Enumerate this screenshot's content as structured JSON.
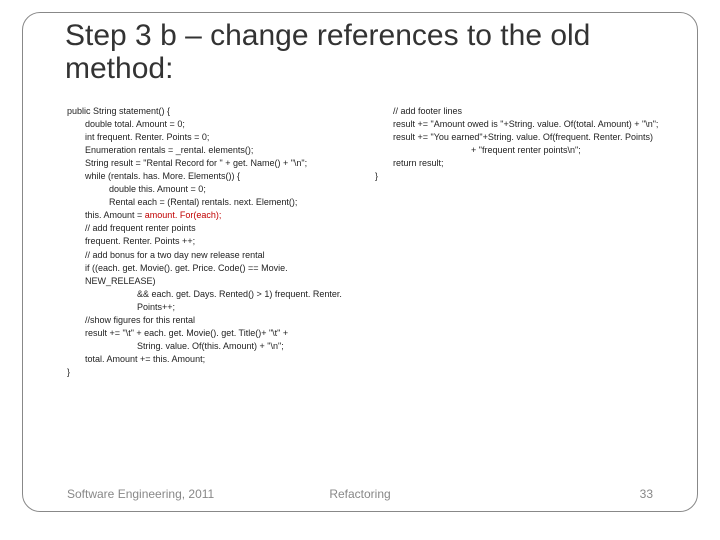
{
  "slide": {
    "title": "Step 3 b – change references to the old method:"
  },
  "code": {
    "left": {
      "l0": "public String statement() {",
      "l1": "double total. Amount = 0;",
      "l2": "int frequent. Renter. Points = 0;",
      "l3": "Enumeration rentals = _rental. elements();",
      "l4": "String result = \"Rental Record for \" + get. Name() + \"\\n\";",
      "l5": "while (rentals. has. More. Elements()) {",
      "l6": "double this. Amount = 0;",
      "l7": "Rental each = (Rental) rentals. next. Element();",
      "l8a": "this. Amount = ",
      "l8b": "amount. For(each);",
      "l9": "// add frequent renter points",
      "l10": "frequent. Renter. Points ++;",
      "l11": "// add bonus for a two day new release rental",
      "l12": "if ((each. get. Movie(). get. Price. Code() == Movie. NEW_RELEASE)",
      "l13": "&&  each. get. Days. Rented() > 1) frequent. Renter. Points++;",
      "l14": "//show figures for this rental",
      "l15": "result += \"\\t\" + each. get. Movie(). get. Title()+ \"\\t\" +",
      "l16": "String. value. Of(this. Amount) + \"\\n\";",
      "l17": "total. Amount += this. Amount;",
      "l18": "}"
    },
    "right": {
      "r0": "// add footer lines",
      "r1": "result += \"Amount owed is \"+String. value. Of(total. Amount) + \"\\n\";",
      "r2": "result += \"You earned\"+String. value. Of(frequent. Renter. Points)",
      "r3": "+  \"frequent renter points\\n\";",
      "r4": "return result;",
      "r5": "}"
    }
  },
  "footer": {
    "left": "Software Engineering, 2011",
    "center": "Refactoring",
    "right": "33"
  }
}
